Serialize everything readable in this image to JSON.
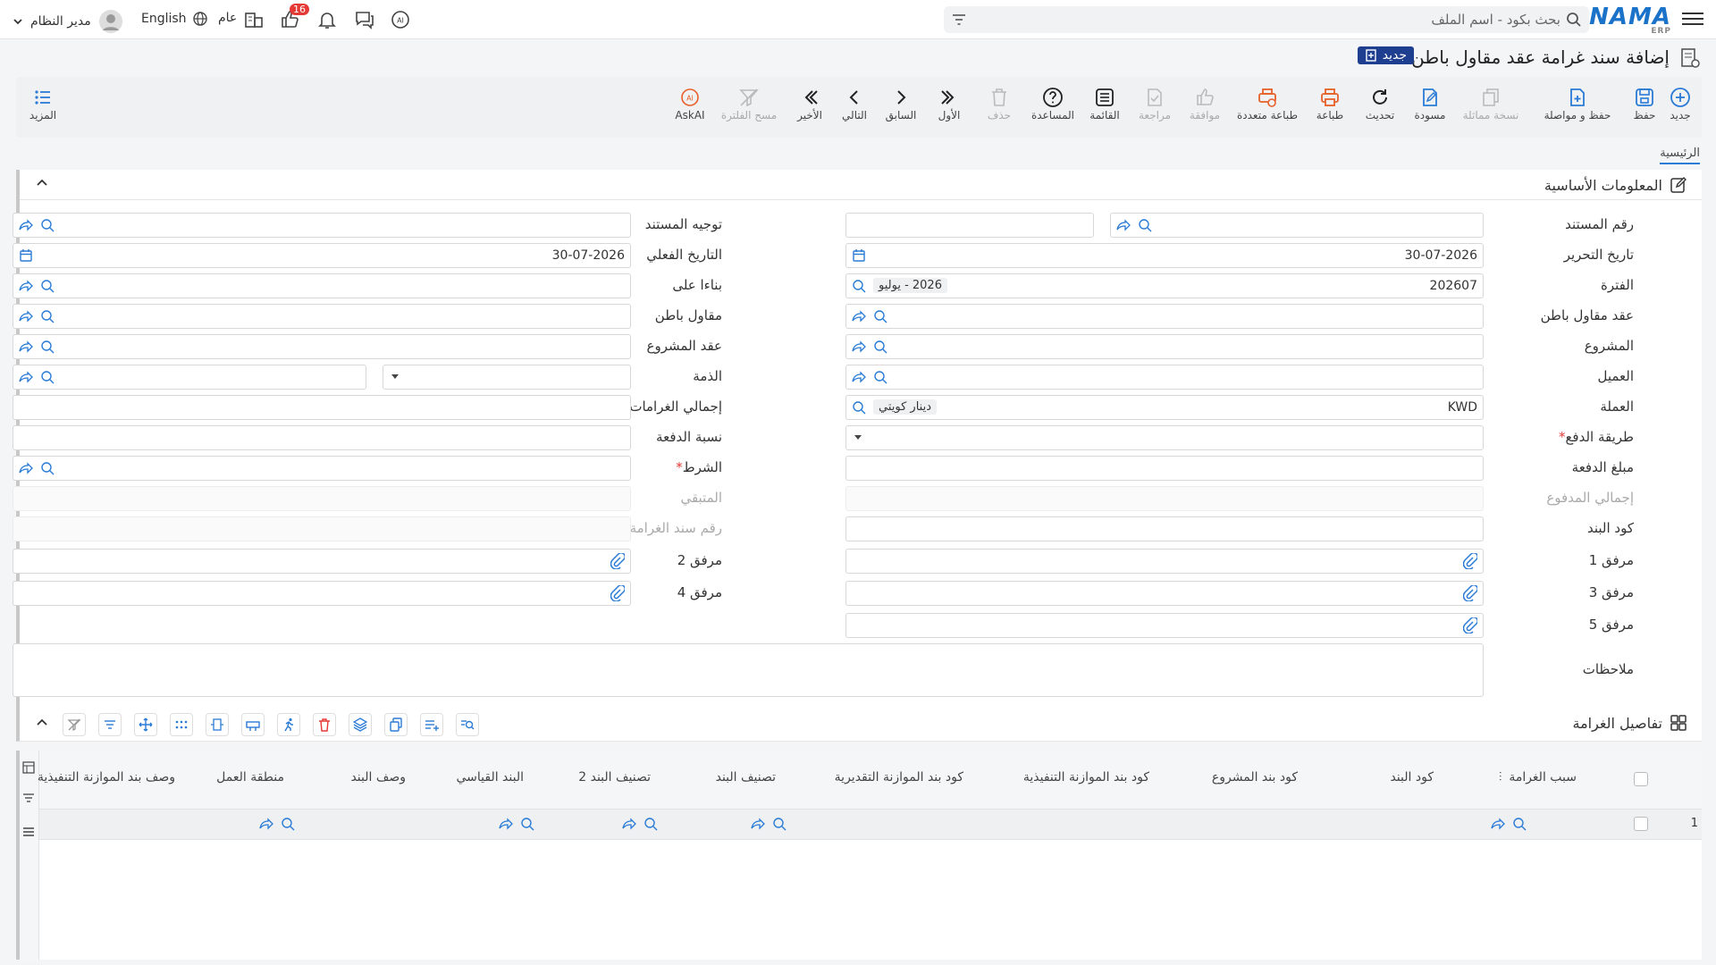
{
  "topbar": {
    "search_placeholder": "بحث بكود - اسم الملف",
    "logo_text": "NAMA",
    "logo_sub": "ERP",
    "user_name": "مدير النظام",
    "language": "English",
    "scope": "عام",
    "notif_count": "16"
  },
  "title": {
    "text": "إضافة سند غرامة عقد مقاول باطن",
    "new_badge": "جديد"
  },
  "toolbar": {
    "new": "جديد",
    "save": "حفظ",
    "save_continue": "حفظ و مواصلة",
    "duplicate": "نسخة مماثلة",
    "draft": "مسودة",
    "refresh": "تحديث",
    "print": "طباعة",
    "multi_print": "طباعة متعددة",
    "approve": "موافقة",
    "review": "مراجعة",
    "list": "القائمة",
    "help": "المساعدة",
    "delete": "حذف",
    "first": "الأول",
    "previous": "السابق",
    "next": "التالي",
    "last": "الأخير",
    "clear_filter": "مسح الفلترة",
    "askai": "AskAI",
    "more": "المزيد"
  },
  "tabs": {
    "main": "الرئيسية"
  },
  "basic": {
    "section_title": "المعلومات الأساسية",
    "doc_number_label": "رقم المستند",
    "doc_direction_label": "توجيه المستند",
    "edit_date_label": "تاريخ التحرير",
    "edit_date": "30-07-2026",
    "actual_date_label": "التاريخ الفعلي",
    "actual_date": "30-07-2026",
    "period_label": "الفترة",
    "period_code": "202607",
    "period_name": "2026 - يوليو",
    "based_on_label": "بناءا على",
    "subcontract_label": "عقد مقاول باطن",
    "subcontractor_label": "مقاول باطن",
    "project_label": "المشروع",
    "project_contract_label": "عقد المشروع",
    "customer_label": "العميل",
    "liability_label": "الذمة",
    "currency_label": "العملة",
    "currency_code": "KWD",
    "currency_name": "دينار كويتي",
    "total_fines_label": "إجمالي الغرامات",
    "payment_method_label": "طريقة الدفع",
    "payment_ratio_label": "نسبة الدفعة",
    "payment_amount_label": "مبلغ الدفعة",
    "condition_label": "الشرط",
    "total_paid_label": "إجمالي المدفوع",
    "remaining_label": "المتبقي",
    "item_code_label": "كود البند",
    "fine_doc_number_label": "رقم سند الغرامة",
    "attachment1_label": "مرفق 1",
    "attachment2_label": "مرفق 2",
    "attachment3_label": "مرفق 3",
    "attachment4_label": "مرفق 4",
    "attachment5_label": "مرفق 5",
    "notes_label": "ملاحظات"
  },
  "details": {
    "section_title": "تفاصيل الغرامة",
    "columns": [
      "سبب الغرامة",
      "كود البند",
      "كود بند المشروع",
      "كود بند الموازنة التنفيذية",
      "كود بند الموازنة التقديرية",
      "تصنيف البند",
      "تصنيف البند 2",
      "البند القياسي",
      "وصف البند",
      "منطقة العمل",
      "وصف بند الموازنة التنفيذية"
    ],
    "row_number": "1"
  }
}
